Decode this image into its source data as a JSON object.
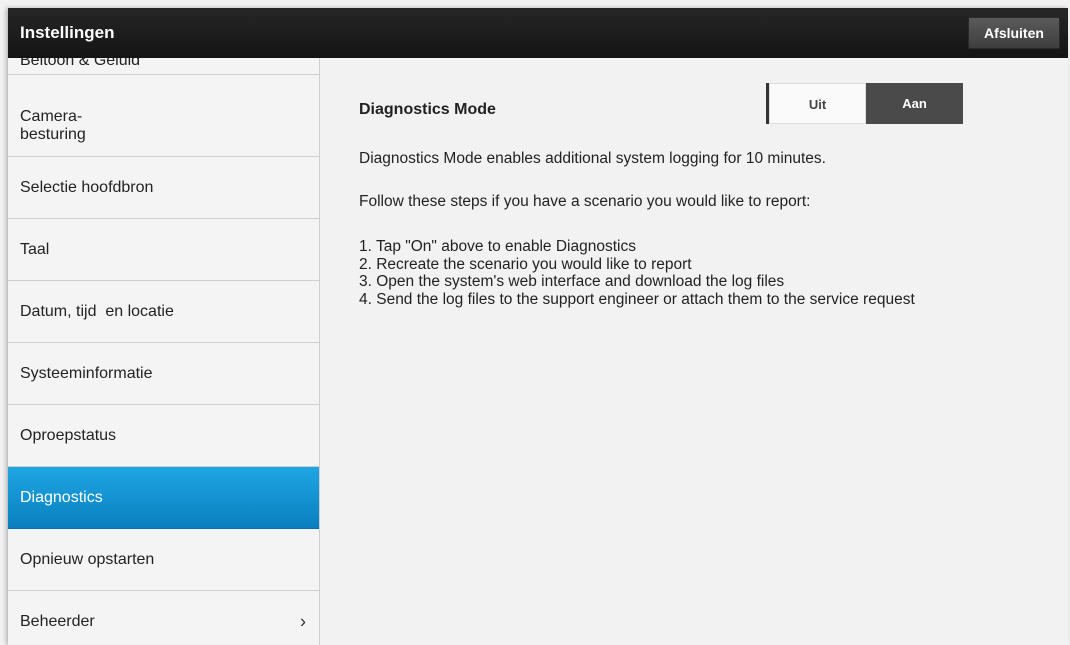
{
  "header": {
    "title": "Instellingen",
    "exit_label": "Afsluiten"
  },
  "sidebar": {
    "items": [
      {
        "label": "Beltoon & Geluid"
      },
      {
        "label": "Camera-\nbesturing"
      },
      {
        "label": "Selectie hoofdbron"
      },
      {
        "label": "Taal"
      },
      {
        "label": "Datum, tijd  en locatie"
      },
      {
        "label": "Systeeminformatie"
      },
      {
        "label": "Oproepstatus"
      },
      {
        "label": "Diagnostics",
        "active": true
      },
      {
        "label": "Opnieuw opstarten"
      },
      {
        "label": "Beheerder",
        "chevron": "›"
      }
    ]
  },
  "main": {
    "title": "Diagnostics Mode",
    "toggle": {
      "off_label": "Uit",
      "on_label": "Aan",
      "selected": "Uit"
    },
    "description": "Diagnostics Mode enables additional system logging for 10 minutes.",
    "steps_intro": "Follow these steps if you have a scenario you would like to report:",
    "steps": [
      "1. Tap \"On\" above to enable Diagnostics",
      "2. Recreate the scenario you would like to report",
      "3. Open the system's web interface and download the log files",
      "4. Send the log files to the support engineer or attach them to the service request"
    ]
  },
  "colors": {
    "header_bg": "#1b1b1b",
    "active_item": "#1597d6",
    "toggle_on_bg": "#4a4a4a"
  }
}
